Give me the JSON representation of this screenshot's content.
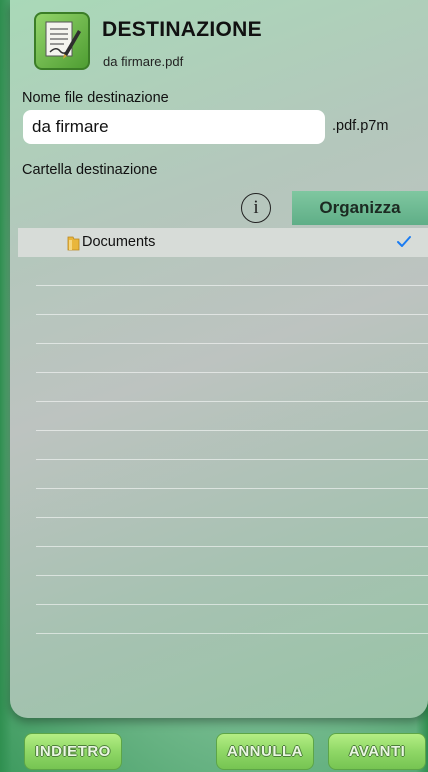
{
  "header": {
    "title": "DESTINAZIONE",
    "subtitle": "da firmare.pdf",
    "icon": "document-sign-icon"
  },
  "form": {
    "filename_label": "Nome file destinazione",
    "filename_value": "da firmare",
    "extension": ".pdf.p7m",
    "folder_label": "Cartella destinazione"
  },
  "toolbar": {
    "info_symbol": "i",
    "organize_label": "Organizza"
  },
  "folders": [
    {
      "name": "Documents",
      "selected": true,
      "icon": "folder-icon"
    }
  ],
  "footer": {
    "back_label": "INDIETRO",
    "cancel_label": "ANNULLA",
    "next_label": "AVANTI"
  },
  "colors": {
    "accent_green": "#8fd766",
    "organize_bg": "#6fbb94",
    "check_blue": "#1a7cf2"
  }
}
